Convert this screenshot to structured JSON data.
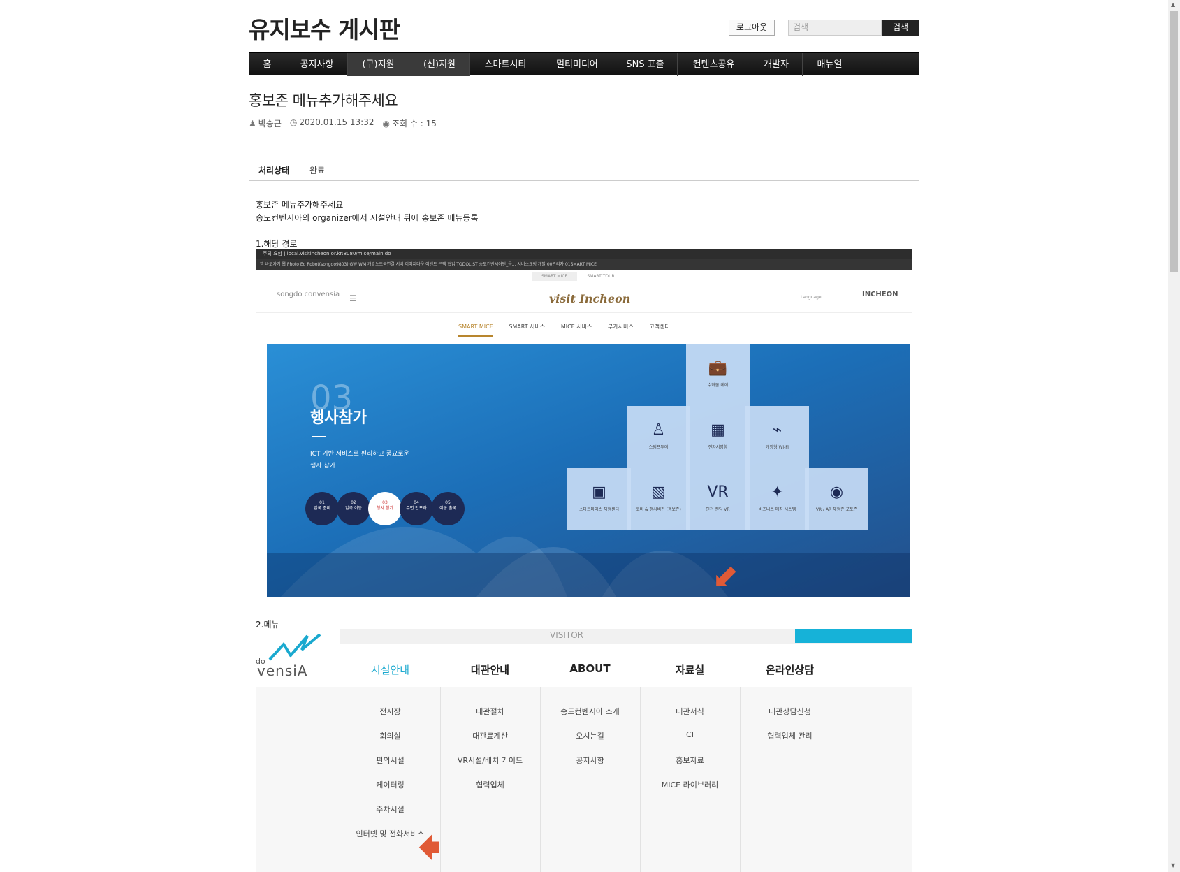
{
  "site": {
    "title": "유지보수 게시판"
  },
  "header": {
    "logout_label": "로그아웃",
    "search_placeholder": "검색",
    "search_button": "검색"
  },
  "nav": {
    "items": [
      "홈",
      "공지사항",
      "(구)지원",
      "(신)지원",
      "스마트시티",
      "멀티미디어",
      "SNS 표출",
      "컨텐츠공유",
      "개발자",
      "매뉴얼"
    ],
    "active": [
      "(구)지원",
      "(신)지원"
    ]
  },
  "post": {
    "title": "홍보존 메뉴추가해주세요",
    "author": "박승근",
    "datetime": "2020.01.15 13:32",
    "views": "조회 수 : 15",
    "status_label": "처리상태",
    "status_value": "완료",
    "body_line1": "홍보존 메뉴추가해주세요",
    "body_line2": "송도컨벤시아의 organizer에서 시설안내 뒤에 홍보존 메뉴등록",
    "section1": "1.해당 경로",
    "section2": "2.메뉴"
  },
  "shot1": {
    "url": "주의 요함 | local.visitincheon.or.kr:8080/mice/main.do",
    "bookmarks": "앱  바로가기  웹  Photo Ed  Robot(songdo9803)  GW  WM  개발노트북연결  서버  이미지다운  이벤트  은팩  협업  TODOLIST  송도컨벤시아단_운...  서비스요청  개발  00관리자  01SMART MICE",
    "tabs": [
      "SMART MICE",
      "SMART TOUR"
    ],
    "logo": "songdo convensia",
    "brand": "visit Incheon",
    "lang": "Language",
    "incheon": "INCHEON",
    "menu": [
      "SMART MICE",
      "SMART 서비스",
      "MICE 서비스",
      "부가서비스",
      "고객센터"
    ],
    "num": "03",
    "heading": "행사참가",
    "desc1": "ICT 기반 서비스로 편리하고 풍요로운",
    "desc2": "행사 참가",
    "circles": [
      {
        "n": "01",
        "t": "입국 준비"
      },
      {
        "n": "02",
        "t": "입국 이동"
      },
      {
        "n": "03",
        "t": "행사 참가"
      },
      {
        "n": "04",
        "t": "주변 인프라"
      },
      {
        "n": "05",
        "t": "이동 출국"
      }
    ],
    "tiles": [
      {
        "label": "수하물 케어",
        "icon": "luggage-icon"
      },
      {
        "label": "스탬프투어",
        "icon": "stamp-icon"
      },
      {
        "label": "전자서명함",
        "icon": "grid-icon"
      },
      {
        "label": "개방형 Wi-Fi",
        "icon": "wifi-icon"
      },
      {
        "label": "스마트마이스 체험센터",
        "icon": "map-icon"
      },
      {
        "label": "로비 & 행사비전 (홍보존)",
        "icon": "cube-icon"
      },
      {
        "label": "인천 랜딩 VR",
        "icon": "vr-icon"
      },
      {
        "label": "비즈니스 매칭 시스템",
        "icon": "handshake-icon"
      },
      {
        "label": "VR / AR 체험존 포토존",
        "icon": "goggles-icon"
      }
    ]
  },
  "shot2": {
    "visitor": "VISITOR",
    "logo_text": "vensiA",
    "logo_prefix": "do",
    "columns": [
      {
        "head": "시설안내",
        "items": [
          "전시장",
          "회의실",
          "편의시설",
          "케이터링",
          "주차시설",
          "인터넷 및 전화서비스"
        ]
      },
      {
        "head": "대관안내",
        "items": [
          "대관절차",
          "대관료계산",
          "VR시설/배치 가이드",
          "협력업체"
        ]
      },
      {
        "head": "ABOUT",
        "items": [
          "송도컨벤시아 소개",
          "오시는길",
          "공지사항"
        ]
      },
      {
        "head": "자료실",
        "items": [
          "대관서식",
          "CI",
          "홍보자료",
          "MICE 라이브러리"
        ]
      },
      {
        "head": "온라인상담",
        "items": [
          "대관상담신청",
          "협력업체 관리"
        ]
      }
    ]
  },
  "colors": {
    "accent_blue": "#1aa9cf",
    "arrow": "#e05a36",
    "nav_bg": "#1a1a1a",
    "brand_gold": "#b8862e"
  }
}
